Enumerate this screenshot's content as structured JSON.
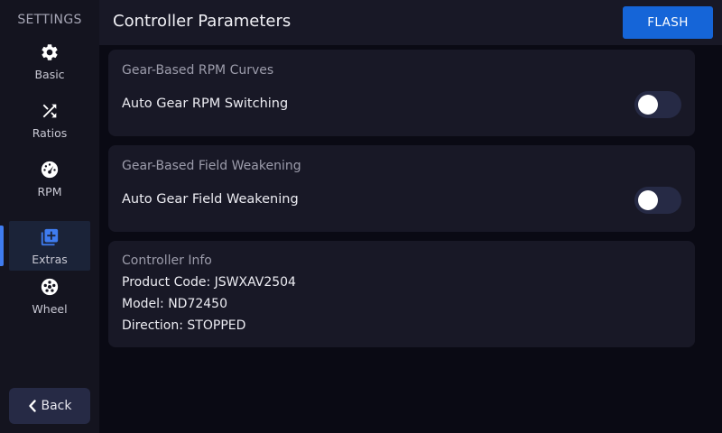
{
  "sidebar": {
    "title": "SETTINGS",
    "items": [
      {
        "label": "Basic",
        "icon": "gear-icon"
      },
      {
        "label": "Ratios",
        "icon": "shuffle-icon"
      },
      {
        "label": "RPM",
        "icon": "speedometer-icon"
      },
      {
        "label": "Extras",
        "icon": "add-collection-icon",
        "active": true
      },
      {
        "label": "Wheel",
        "icon": "wheel-icon"
      }
    ],
    "back_label": "Back"
  },
  "header": {
    "title": "Controller Parameters",
    "flash_label": "FLASH"
  },
  "sections": {
    "rpm_curves": {
      "title": "Gear-Based RPM Curves",
      "toggle_label": "Auto Gear RPM Switching",
      "toggle_on": false
    },
    "field_weakening": {
      "title": "Gear-Based Field Weakening",
      "toggle_label": "Auto Gear Field Weakening",
      "toggle_on": false
    },
    "controller_info": {
      "title": "Controller Info",
      "product_code": "Product Code: JSWXAV2504",
      "model": "Model: ND72450",
      "direction": "Direction: STOPPED"
    }
  },
  "colors": {
    "accent": "#1565d8",
    "active_indicator": "#3f7cf0",
    "card_bg": "#181826",
    "page_bg": "#0a0a14"
  }
}
